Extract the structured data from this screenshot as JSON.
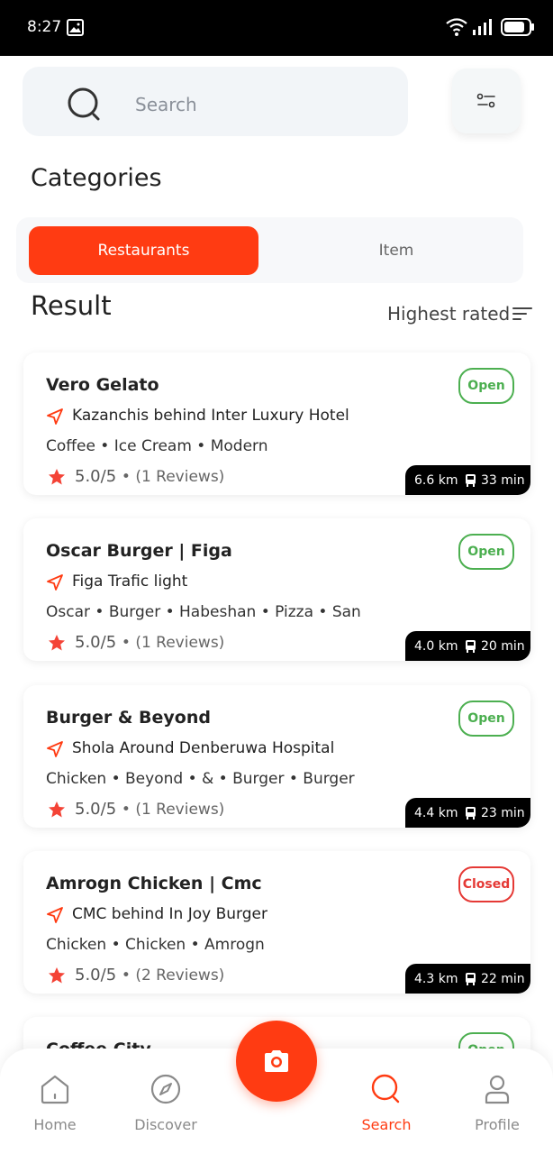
{
  "status_bar": {
    "time": "8:27"
  },
  "search": {
    "placeholder": "Search"
  },
  "categories": {
    "title": "Categories",
    "tabs": [
      "Restaurants",
      "Item"
    ],
    "active_tab": "Restaurants"
  },
  "result": {
    "title": "Result",
    "sort_label": "Highest rated"
  },
  "restaurants": [
    {
      "name": "Vero Gelato",
      "status": "Open",
      "address": "Kazanchis behind Inter Luxury Hotel",
      "tags": "Coffee • Ice Cream • Modern",
      "rating": "5.0/5",
      "reviews": "• (1 Reviews)",
      "distance": "6.6 km",
      "time": "33 min"
    },
    {
      "name": "Oscar Burger | Figa",
      "status": "Open",
      "address": "Figa Trafic light",
      "tags": "Oscar • Burger • Habeshan • Pizza • San",
      "rating": "5.0/5",
      "reviews": "• (1 Reviews)",
      "distance": "4.0 km",
      "time": "20 min"
    },
    {
      "name": "Burger & Beyond",
      "status": "Open",
      "address": "Shola Around Denberuwa Hospital",
      "tags": "Chicken • Beyond • & • Burger • Burger",
      "rating": "5.0/5",
      "reviews": "• (1 Reviews)",
      "distance": "4.4 km",
      "time": "23 min"
    },
    {
      "name": "Amrogn Chicken | Cmc",
      "status": "Closed",
      "address": "CMC behind In Joy Burger",
      "tags": "Chicken • Chicken • Amrogn",
      "rating": "5.0/5",
      "reviews": "• (2 Reviews)",
      "distance": "4.3 km",
      "time": "22 min"
    },
    {
      "name": "Coffee City",
      "status": "Open"
    }
  ],
  "nav": {
    "home": "Home",
    "discover": "Discover",
    "search": "Search",
    "profile": "Profile",
    "active": "Search"
  },
  "colors": {
    "accent": "#ff3b12",
    "open": "#4caf50",
    "closed": "#e53935"
  }
}
